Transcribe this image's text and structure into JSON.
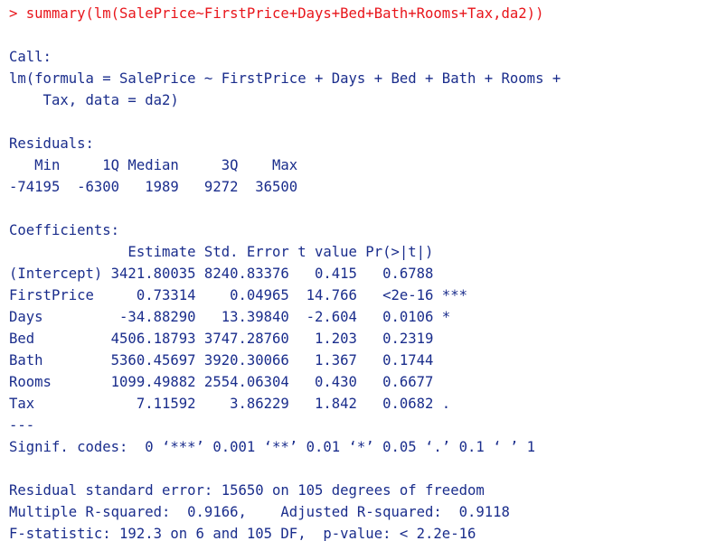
{
  "console": {
    "lines": [
      {
        "text": "> summary(lm(SalePrice~FirstPrice+Days+Bed+Bath+Rooms+Tax,da2))",
        "kind": "input"
      },
      {
        "text": "",
        "kind": "output"
      },
      {
        "text": "Call:",
        "kind": "output"
      },
      {
        "text": "lm(formula = SalePrice ~ FirstPrice + Days + Bed + Bath + Rooms +",
        "kind": "output"
      },
      {
        "text": "    Tax, data = da2)",
        "kind": "output"
      },
      {
        "text": "",
        "kind": "output"
      },
      {
        "text": "Residuals:",
        "kind": "output"
      },
      {
        "text": "   Min     1Q Median     3Q    Max ",
        "kind": "output"
      },
      {
        "text": "-74195  -6300   1989   9272  36500 ",
        "kind": "output"
      },
      {
        "text": "",
        "kind": "output"
      },
      {
        "text": "Coefficients:",
        "kind": "output"
      },
      {
        "text": "              Estimate Std. Error t value Pr(>|t|)    ",
        "kind": "output"
      },
      {
        "text": "(Intercept) 3421.80035 8240.83376   0.415   0.6788    ",
        "kind": "output"
      },
      {
        "text": "FirstPrice     0.73314    0.04965  14.766   <2e-16 ***",
        "kind": "output"
      },
      {
        "text": "Days         -34.88290   13.39840  -2.604   0.0106 *  ",
        "kind": "output"
      },
      {
        "text": "Bed         4506.18793 3747.28760   1.203   0.2319    ",
        "kind": "output"
      },
      {
        "text": "Bath        5360.45697 3920.30066   1.367   0.1744    ",
        "kind": "output"
      },
      {
        "text": "Rooms       1099.49882 2554.06304   0.430   0.6677    ",
        "kind": "output"
      },
      {
        "text": "Tax            7.11592    3.86229   1.842   0.0682 .  ",
        "kind": "output"
      },
      {
        "text": "---",
        "kind": "output"
      },
      {
        "text": "Signif. codes:  0 ‘***’ 0.001 ‘**’ 0.01 ‘*’ 0.05 ‘.’ 0.1 ‘ ’ 1",
        "kind": "output"
      },
      {
        "text": "",
        "kind": "output"
      },
      {
        "text": "Residual standard error: 15650 on 105 degrees of freedom",
        "kind": "output"
      },
      {
        "text": "Multiple R-squared:  0.9166,    Adjusted R-squared:  0.9118 ",
        "kind": "output"
      },
      {
        "text": "F-statistic: 192.3 on 6 and 105 DF,  p-value: < 2.2e-16",
        "kind": "output"
      }
    ]
  },
  "colors": {
    "input": "#e8151b",
    "output": "#1a2d8c",
    "background": "#ffffff"
  }
}
